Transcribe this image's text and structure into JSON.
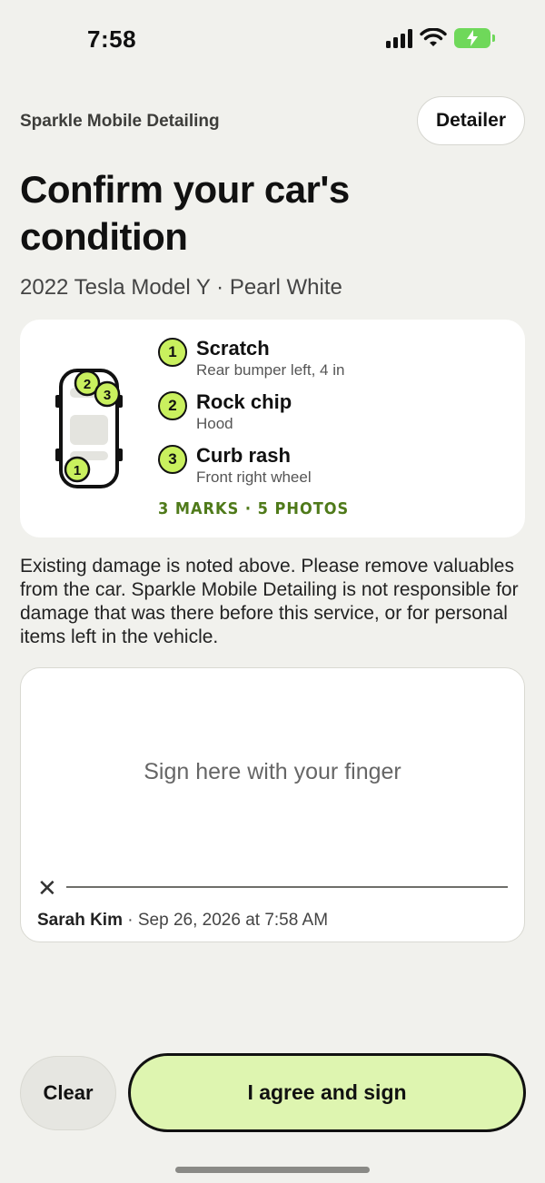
{
  "status": {
    "time": "7:58"
  },
  "header": {
    "brand": "Sparkle Mobile Detailing",
    "role_button": "Detailer"
  },
  "title": "Confirm your car's condition",
  "vehicle": "2022 Tesla Model Y · Pearl White",
  "damage": {
    "items": [
      {
        "number": "1",
        "name": "Scratch",
        "detail": "Rear bumper left, 4 in"
      },
      {
        "number": "2",
        "name": "Rock chip",
        "detail": "Hood"
      },
      {
        "number": "3",
        "name": "Curb rash",
        "detail": "Front right wheel"
      }
    ],
    "summary": "3 MARKS · 5 PHOTOS"
  },
  "disclaimer": "Existing damage is noted above. Please remove valuables from the car. Sparkle Mobile Detailing is not responsible for damage that was there before this service, or for personal items left in the vehicle.",
  "signature": {
    "placeholder": "Sign here with your finger",
    "x_mark": "✕",
    "signer_name": "Sarah Kim",
    "signed_at": "· Sep 26, 2026 at 7:58 AM"
  },
  "actions": {
    "clear": "Clear",
    "agree": "I agree and sign"
  },
  "colors": {
    "accent": "#c9f05e",
    "agree_bg": "#def5b0",
    "summary_text": "#4f7a1a",
    "background": "#f1f1ed"
  }
}
